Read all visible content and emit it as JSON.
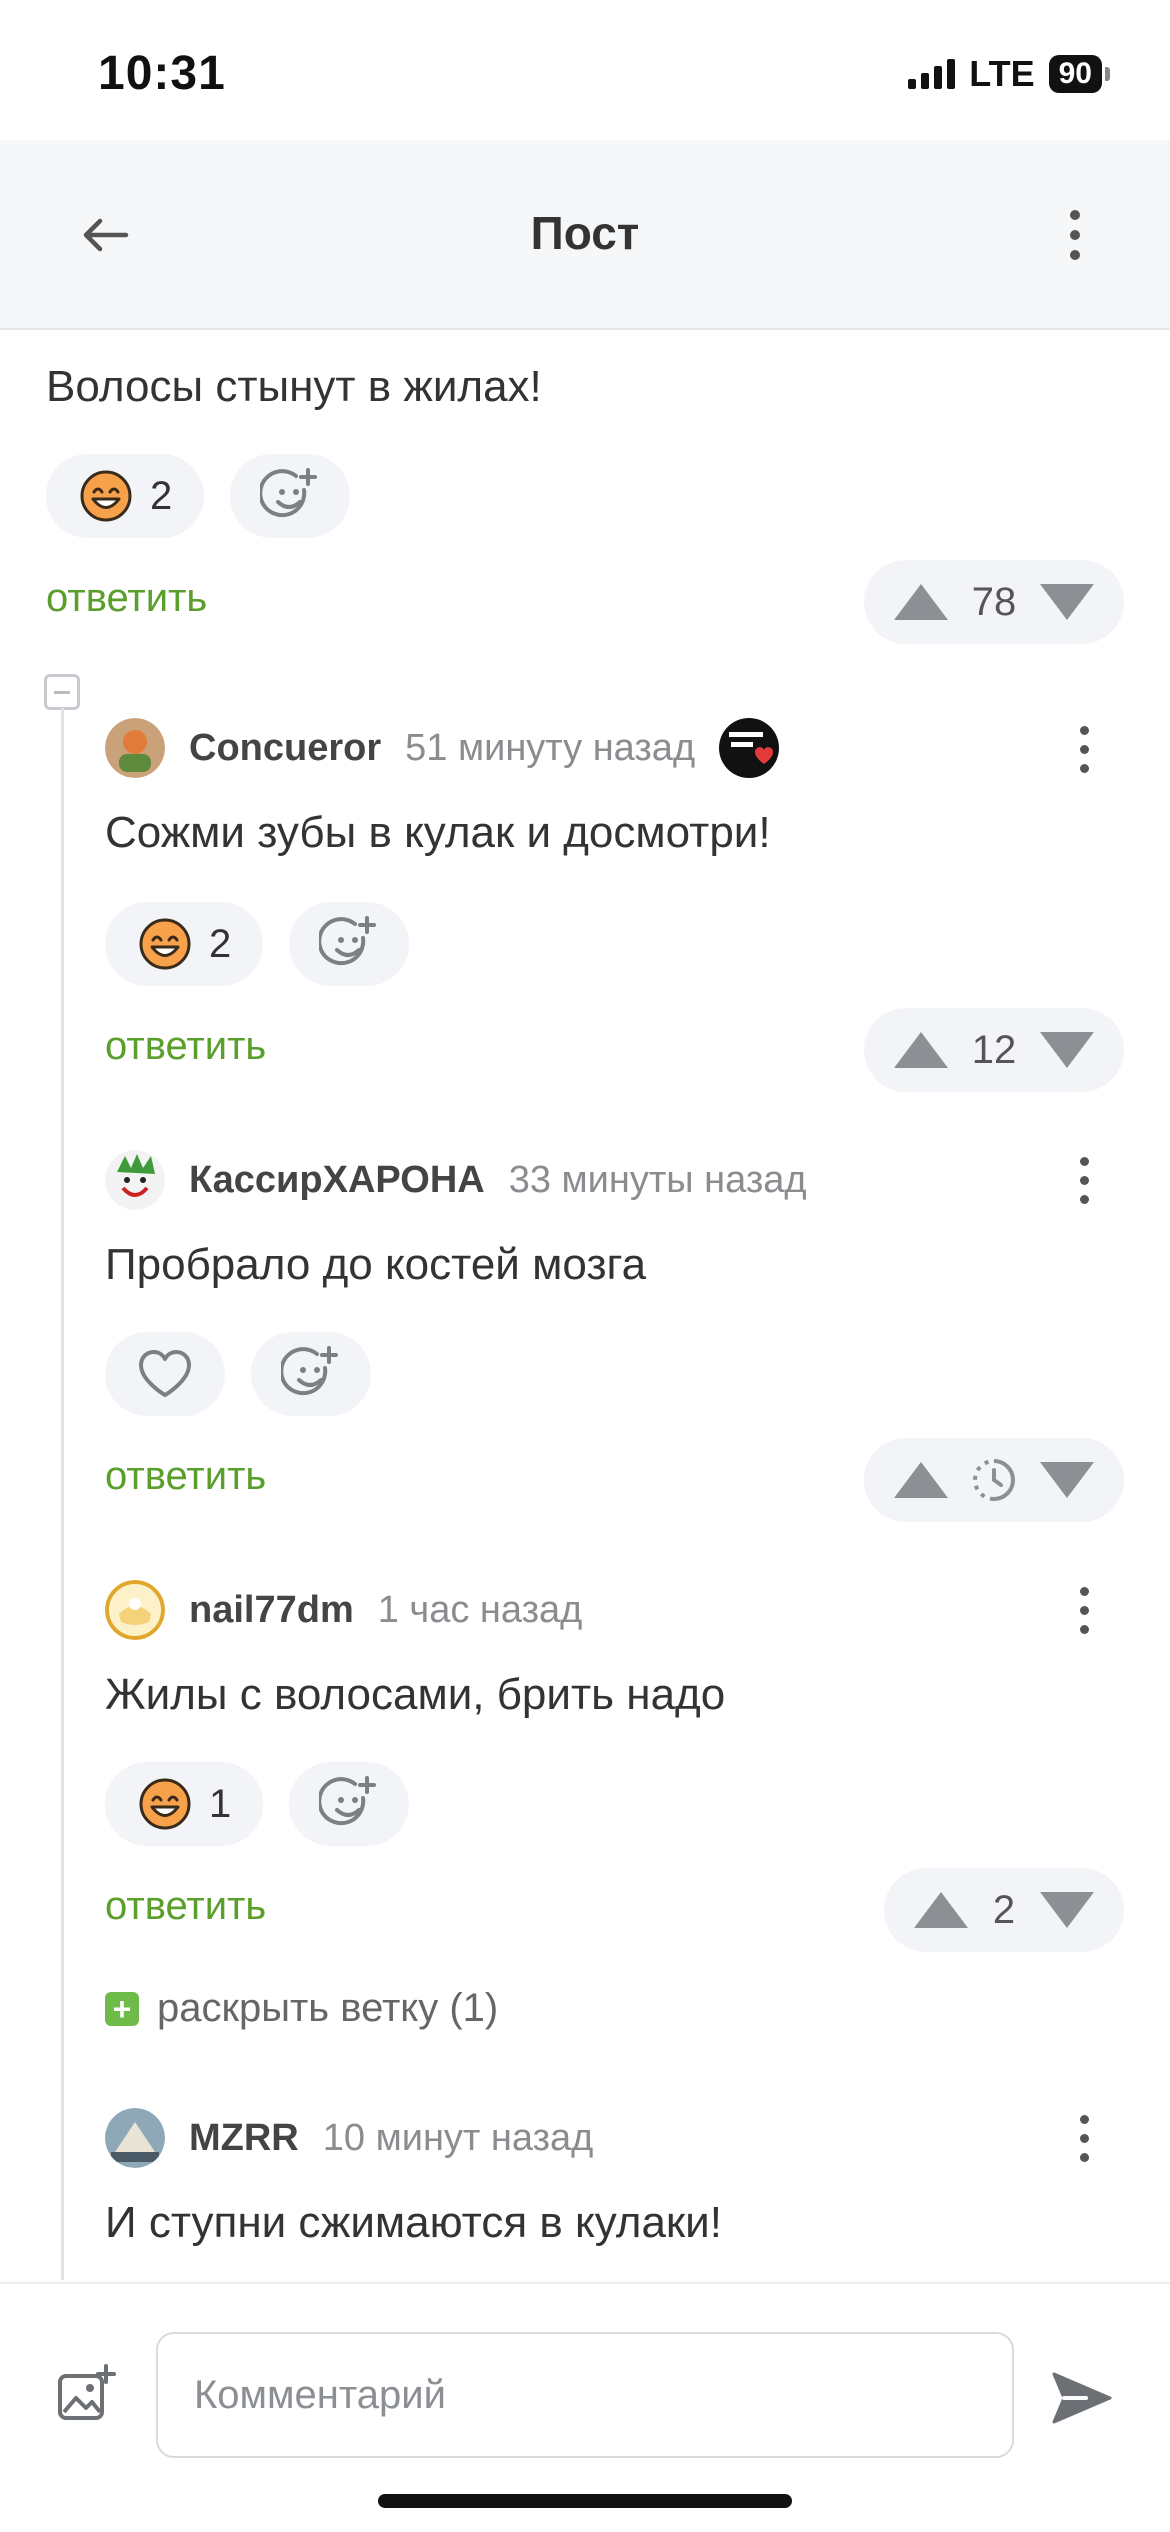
{
  "status_bar": {
    "time": "10:31",
    "network": "LTE",
    "battery": "90"
  },
  "header": {
    "title": "Пост"
  },
  "top_comment": {
    "text": "Волосы стынут в жилах!",
    "reaction_count": "2",
    "reply_label": "ответить",
    "rating": "78"
  },
  "comments": [
    {
      "author": "Concueror",
      "time": "51 минуту назад",
      "text": "Сожми зубы в кулак и досмотри!",
      "reaction_count": "2",
      "reply_label": "ответить",
      "rating": "12"
    },
    {
      "author": "КассирХАРОНА",
      "time": "33 минуты назад",
      "text": "Пробрало до костей мозга",
      "reply_label": "ответить"
    },
    {
      "author": "nail77dm",
      "time": "1 час назад",
      "text": "Жилы с волосами, брить надо",
      "reaction_count": "1",
      "reply_label": "ответить",
      "rating": "2"
    },
    {
      "author": "MZRR",
      "time": "10 минут назад",
      "text": "И ступни сжимаются в кулаки!"
    }
  ],
  "expand_branch": {
    "label": "раскрыть ветку (1)"
  },
  "composer": {
    "placeholder": "Комментарий"
  },
  "colors": {
    "reply_green": "#5a9e2b",
    "pill_bg": "#f2f4f7",
    "expand_green": "#6fbb4a"
  }
}
